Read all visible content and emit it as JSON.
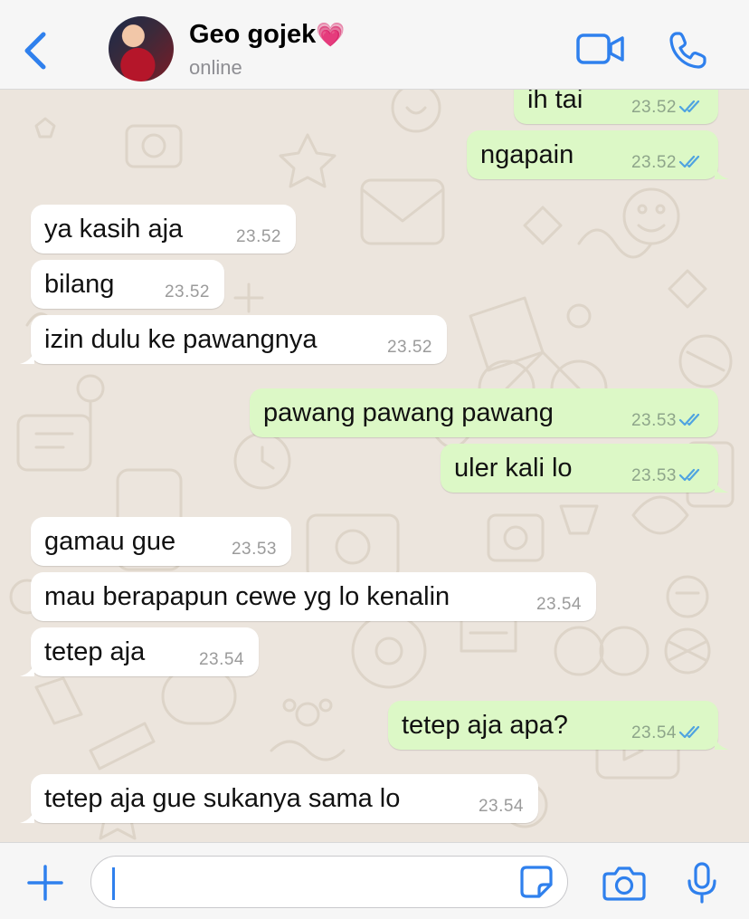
{
  "header": {
    "contact_name": "Geo gojek",
    "name_emoji": "💗",
    "status": "online"
  },
  "messages": [
    {
      "dir": "out",
      "text": "ih tai",
      "time": "23.52",
      "read": true
    },
    {
      "dir": "out",
      "text": "ngapain",
      "time": "23.52",
      "read": true
    },
    {
      "dir": "in",
      "text": "ya kasih aja",
      "time": "23.52"
    },
    {
      "dir": "in",
      "text": "bilang",
      "time": "23.52"
    },
    {
      "dir": "in",
      "text": "izin dulu ke pawangnya",
      "time": "23.52"
    },
    {
      "dir": "out",
      "text": "pawang pawang pawang",
      "time": "23.53",
      "read": true
    },
    {
      "dir": "out",
      "text": "uler kali lo",
      "time": "23.53",
      "read": true
    },
    {
      "dir": "in",
      "text": "gamau gue",
      "time": "23.53"
    },
    {
      "dir": "in",
      "text": "mau berapapun cewe yg lo kenalin",
      "time": "23.54"
    },
    {
      "dir": "in",
      "text": "tetep aja",
      "time": "23.54"
    },
    {
      "dir": "out",
      "text": "tetep aja apa?",
      "time": "23.54",
      "read": true
    },
    {
      "dir": "in",
      "text": "tetep aja gue sukanya sama lo",
      "time": "23.54"
    }
  ],
  "input": {
    "value": "",
    "placeholder": ""
  },
  "icons": {
    "back": "chevron-left-icon",
    "video": "video-camera-icon",
    "call": "phone-icon",
    "plus": "plus-icon",
    "sticker": "sticker-icon",
    "camera": "camera-icon",
    "mic": "microphone-icon"
  },
  "colors": {
    "accent": "#2f80ed",
    "incoming_bubble": "#ffffff",
    "outgoing_bubble": "#dcf8c6",
    "chat_background": "#ece5dd",
    "read_ticks": "#4fa3e0"
  }
}
